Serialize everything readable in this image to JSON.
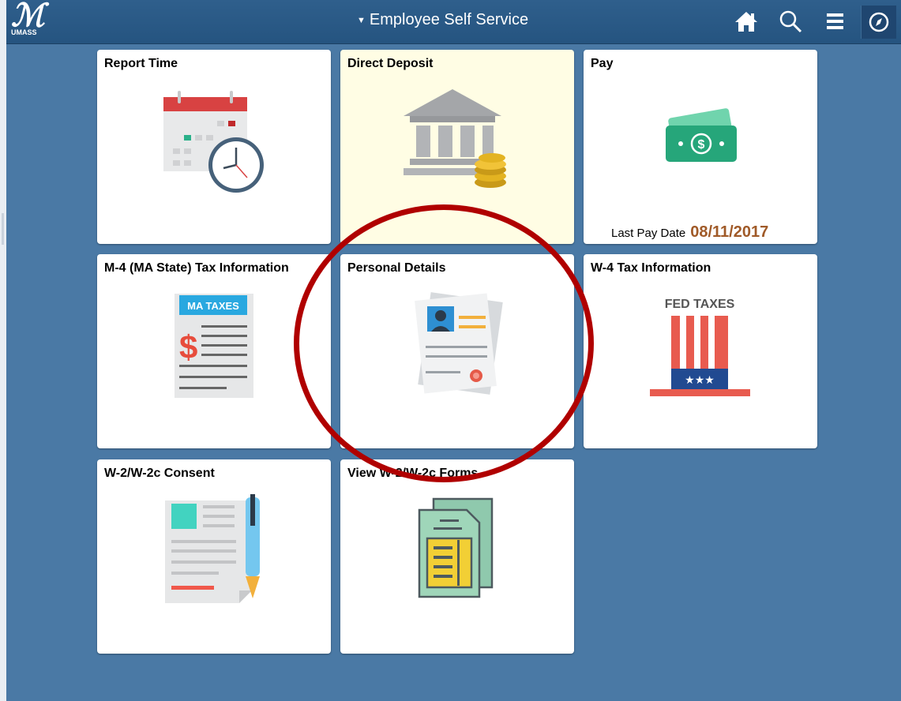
{
  "header": {
    "logo_text": "UMASS",
    "title": "Employee Self Service",
    "icons": [
      "home-icon",
      "search-icon",
      "menu-icon",
      "navbar-compass-icon"
    ]
  },
  "tiles": [
    {
      "title": "Report Time",
      "icon": "calendar-clock-icon"
    },
    {
      "title": "Direct Deposit",
      "icon": "bank-coins-icon"
    },
    {
      "title": "Pay",
      "icon": "money-bill-icon",
      "last_pay_label": "Last Pay Date",
      "last_pay_date": "08/11/2017"
    },
    {
      "title": "M-4 (MA State) Tax Information",
      "icon": "ma-taxes-document-icon",
      "icon_text": "MA TAXES",
      "icon_symbol": "$"
    },
    {
      "title": "Personal Details",
      "icon": "id-card-icon"
    },
    {
      "title": "W-4 Tax Information",
      "icon": "uncle-sam-hat-icon",
      "icon_text": "FED TAXES"
    },
    {
      "title": "W-2/W-2c Consent",
      "icon": "document-pen-icon"
    },
    {
      "title": "View W-2/W-2c Forms",
      "icon": "forms-stack-icon"
    }
  ],
  "colors": {
    "background": "#4a79a5",
    "header": "#2a5a87",
    "highlight_circle": "#b00000",
    "selected_tile": "#fffde4",
    "pay_date": "#a05a28"
  }
}
